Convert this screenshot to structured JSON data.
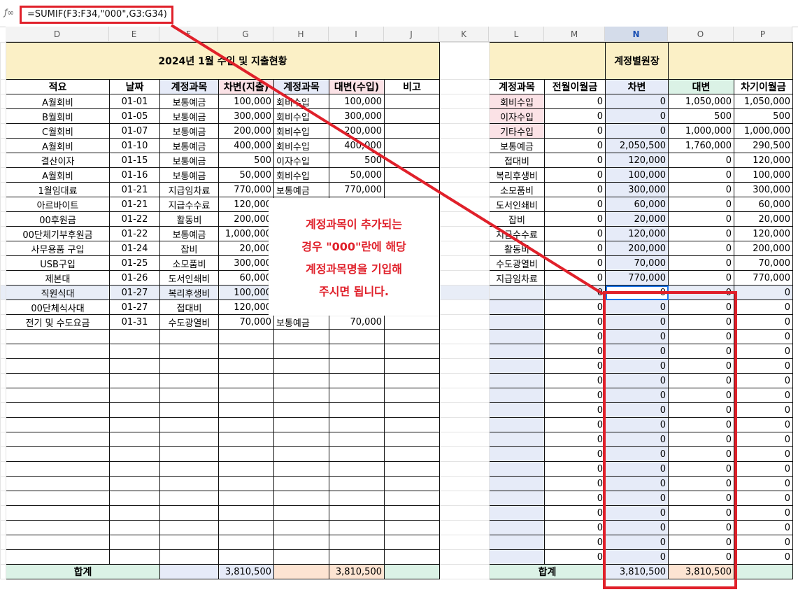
{
  "formula_bar": {
    "fx_icon": "fx-icon",
    "formula": "=SUMIF(F3:F34,\"000\",G3:G34)"
  },
  "columns": [
    "D",
    "E",
    "F",
    "G",
    "H",
    "I",
    "J",
    "K",
    "L",
    "M",
    "N",
    "O",
    "P"
  ],
  "selected_column": "N",
  "left_table": {
    "title": "2024년 1월 수입 및 지출현황",
    "headers": [
      "적요",
      "날짜",
      "계정과목",
      "차변(지출)",
      "계정과목",
      "대변(수입)",
      "비고"
    ],
    "rows": [
      [
        "A월회비",
        "01-01",
        "보통예금",
        "100,000",
        "회비수입",
        "100,000",
        ""
      ],
      [
        "B월회비",
        "01-05",
        "보통예금",
        "300,000",
        "회비수입",
        "300,000",
        ""
      ],
      [
        "C월회비",
        "01-07",
        "보통예금",
        "200,000",
        "회비수입",
        "200,000",
        ""
      ],
      [
        "A월회비",
        "01-10",
        "보통예금",
        "400,000",
        "회비수입",
        "400,000",
        ""
      ],
      [
        "결산이자",
        "01-15",
        "보통예금",
        "500",
        "이자수입",
        "500",
        ""
      ],
      [
        "A월회비",
        "01-16",
        "보통예금",
        "50,000",
        "회비수입",
        "50,000",
        ""
      ],
      [
        "1월임대료",
        "01-21",
        "지급임차료",
        "770,000",
        "보통예금",
        "770,000",
        ""
      ],
      [
        "아르바이트",
        "01-21",
        "지급수수료",
        "120,000",
        "",
        "",
        ""
      ],
      [
        "00후원금",
        "01-22",
        "활동비",
        "200,000",
        "",
        "",
        ""
      ],
      [
        "00단체기부후원금",
        "01-22",
        "보통예금",
        "1,000,000",
        "",
        "",
        ""
      ],
      [
        "사무용품 구입",
        "01-24",
        "잡비",
        "20,000",
        "",
        "",
        ""
      ],
      [
        "USB구입",
        "01-25",
        "소모품비",
        "300,000",
        "",
        "",
        ""
      ],
      [
        "제본대",
        "01-26",
        "도서인쇄비",
        "60,000",
        "",
        "",
        ""
      ],
      [
        "직원식대",
        "01-27",
        "복리후생비",
        "100,000",
        "",
        "",
        ""
      ],
      [
        "00단체식사대",
        "01-27",
        "접대비",
        "120,000",
        "",
        "",
        ""
      ],
      [
        "전기 및 수도요금",
        "01-31",
        "수도광열비",
        "70,000",
        "보통예금",
        "70,000",
        ""
      ]
    ],
    "total_label": "합계",
    "total_debit": "3,810,500",
    "total_credit": "3,810,500"
  },
  "right_table": {
    "title": "계정별원장",
    "headers": [
      "계정과목",
      "전월이월금",
      "차변",
      "대변",
      "차기이월금"
    ],
    "rows": [
      [
        "회비수입",
        "0",
        "0",
        "1,050,000",
        "1,050,000"
      ],
      [
        "이자수입",
        "0",
        "0",
        "500",
        "500"
      ],
      [
        "기타수입",
        "0",
        "0",
        "1,000,000",
        "1,000,000"
      ],
      [
        "보통예금",
        "0",
        "2,050,500",
        "1,760,000",
        "290,500"
      ],
      [
        "접대비",
        "0",
        "120,000",
        "0",
        "120,000"
      ],
      [
        "복리후생비",
        "0",
        "100,000",
        "0",
        "100,000"
      ],
      [
        "소모품비",
        "0",
        "300,000",
        "0",
        "300,000"
      ],
      [
        "도서인쇄비",
        "0",
        "60,000",
        "0",
        "60,000"
      ],
      [
        "잡비",
        "0",
        "20,000",
        "0",
        "20,000"
      ],
      [
        "지급수수료",
        "0",
        "120,000",
        "0",
        "120,000"
      ],
      [
        "활동비",
        "0",
        "200,000",
        "0",
        "200,000"
      ],
      [
        "수도광열비",
        "0",
        "70,000",
        "0",
        "70,000"
      ],
      [
        "지급임차료",
        "0",
        "770,000",
        "0",
        "770,000"
      ]
    ],
    "zero": "0",
    "total_label": "합계",
    "total_debit": "3,810,500",
    "total_credit": "3,810,500"
  },
  "callout": {
    "lines": [
      "계정과목이 추가되는",
      "경우 \"000\"란에 해당",
      "계정과목명을 기입해",
      "주시면 됩니다."
    ]
  },
  "colors": {
    "annotation_red": "#e0202a",
    "selection_blue": "#1a73e8",
    "title_yellow": "#fbf0c6"
  }
}
